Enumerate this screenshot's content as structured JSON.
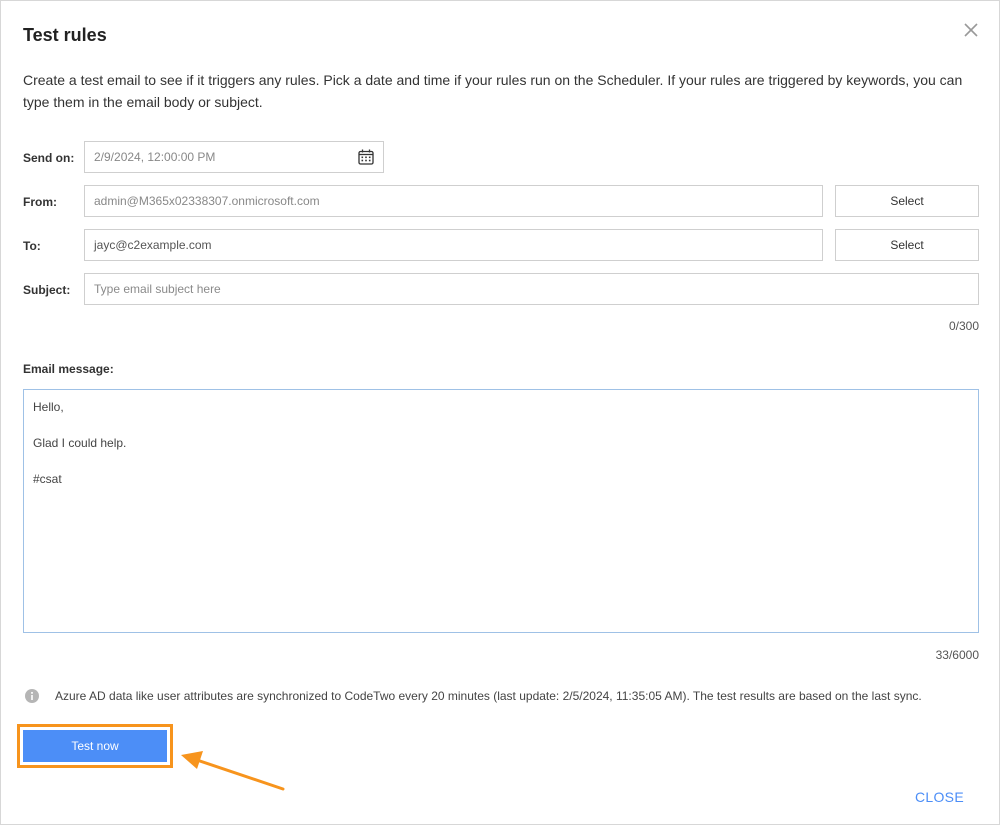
{
  "dialog": {
    "title": "Test rules",
    "intro": "Create a test email to see if it triggers any rules. Pick a date and time if your rules run on the Scheduler. If your rules are triggered by keywords, you can type them in the email body or subject."
  },
  "form": {
    "send_on": {
      "label": "Send on:",
      "value": "2/9/2024, 12:00:00 PM"
    },
    "from": {
      "label": "From:",
      "value": "admin@M365x02338307.onmicrosoft.com",
      "button": "Select"
    },
    "to": {
      "label": "To:",
      "value": "jayc@c2example.com",
      "button": "Select"
    },
    "subject": {
      "label": "Subject:",
      "placeholder": "Type email subject here",
      "counter": "0/300"
    },
    "message": {
      "label": "Email message:",
      "value": "Hello,\n\nGlad I could help.\n\n#csat",
      "counter": "33/6000"
    }
  },
  "info": {
    "text": "Azure AD data like user attributes are synchronized to CodeTwo every 20 minutes (last update: 2/5/2024, 11:35:05 AM). The test results are based on the last sync."
  },
  "actions": {
    "test_now": "Test now",
    "close": "CLOSE"
  },
  "colors": {
    "primary": "#4c8ef7",
    "highlight": "#f7941d",
    "border": "#cfcfcf"
  }
}
